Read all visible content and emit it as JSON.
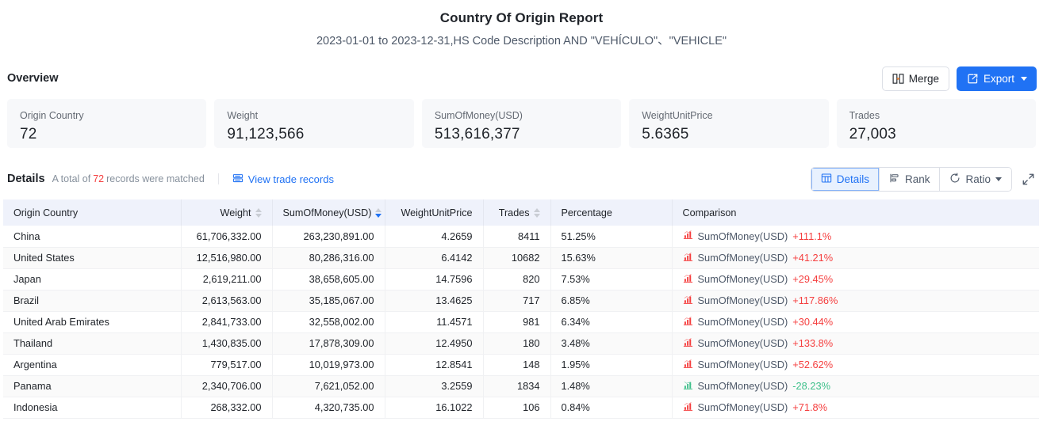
{
  "header": {
    "title": "Country Of Origin Report",
    "subtitle": "2023-01-01 to 2023-12-31,HS Code Description AND \"VEHÍCULO\"、\"VEHICLE\""
  },
  "overview": {
    "label": "Overview",
    "merge_label": "Merge",
    "export_label": "Export",
    "cards": [
      {
        "label": "Origin Country",
        "value": "72"
      },
      {
        "label": "Weight",
        "value": "91,123,566"
      },
      {
        "label": "SumOfMoney(USD)",
        "value": "513,616,377"
      },
      {
        "label": "WeightUnitPrice",
        "value": "5.6365"
      },
      {
        "label": "Trades",
        "value": "27,003"
      }
    ]
  },
  "details": {
    "title": "Details",
    "meta_prefix": "A total of",
    "record_count": "72",
    "meta_suffix": "records were matched",
    "view_trade_records": "View trade records",
    "view_modes": [
      {
        "label": "Details",
        "icon": "table-icon",
        "active": true
      },
      {
        "label": "Rank",
        "icon": "rank-icon",
        "active": false
      },
      {
        "label": "Ratio",
        "icon": "ratio-icon",
        "active": false,
        "caret": true
      }
    ],
    "fullscreen_label": "Fullscreen"
  },
  "table": {
    "columns": [
      {
        "key": "country",
        "label": "Origin Country",
        "align": "left",
        "sortable": false
      },
      {
        "key": "weight",
        "label": "Weight",
        "align": "right",
        "sortable": true,
        "sort": "none"
      },
      {
        "key": "money",
        "label": "SumOfMoney(USD)",
        "align": "right",
        "sortable": true,
        "sort": "desc"
      },
      {
        "key": "unitprice",
        "label": "WeightUnitPrice",
        "align": "right",
        "sortable": false
      },
      {
        "key": "trades",
        "label": "Trades",
        "align": "right",
        "sortable": true,
        "sort": "none"
      },
      {
        "key": "percentage",
        "label": "Percentage",
        "align": "left",
        "sortable": false
      },
      {
        "key": "comparison",
        "label": "Comparison",
        "align": "left",
        "sortable": false
      }
    ],
    "comparison_metric": "SumOfMoney(USD)",
    "rows": [
      {
        "country": "China",
        "weight": "61,706,332.00",
        "money": "263,230,891.00",
        "unitprice": "4.2659",
        "trades": "8411",
        "percentage": "51.25%",
        "delta": "+111.1%",
        "direction": "up"
      },
      {
        "country": "United States",
        "weight": "12,516,980.00",
        "money": "80,286,316.00",
        "unitprice": "6.4142",
        "trades": "10682",
        "percentage": "15.63%",
        "delta": "+41.21%",
        "direction": "up"
      },
      {
        "country": "Japan",
        "weight": "2,619,211.00",
        "money": "38,658,605.00",
        "unitprice": "14.7596",
        "trades": "820",
        "percentage": "7.53%",
        "delta": "+29.45%",
        "direction": "up"
      },
      {
        "country": "Brazil",
        "weight": "2,613,563.00",
        "money": "35,185,067.00",
        "unitprice": "13.4625",
        "trades": "717",
        "percentage": "6.85%",
        "delta": "+117.86%",
        "direction": "up"
      },
      {
        "country": "United Arab Emirates",
        "weight": "2,841,733.00",
        "money": "32,558,002.00",
        "unitprice": "11.4571",
        "trades": "981",
        "percentage": "6.34%",
        "delta": "+30.44%",
        "direction": "up"
      },
      {
        "country": "Thailand",
        "weight": "1,430,835.00",
        "money": "17,878,309.00",
        "unitprice": "12.4950",
        "trades": "180",
        "percentage": "3.48%",
        "delta": "+133.8%",
        "direction": "up"
      },
      {
        "country": "Argentina",
        "weight": "779,517.00",
        "money": "10,019,973.00",
        "unitprice": "12.8541",
        "trades": "148",
        "percentage": "1.95%",
        "delta": "+52.62%",
        "direction": "up"
      },
      {
        "country": "Panama",
        "weight": "2,340,706.00",
        "money": "7,621,052.00",
        "unitprice": "3.2559",
        "trades": "1834",
        "percentage": "1.48%",
        "delta": "-28.23%",
        "direction": "down"
      },
      {
        "country": "Indonesia",
        "weight": "268,332.00",
        "money": "4,320,735.00",
        "unitprice": "16.1022",
        "trades": "106",
        "percentage": "0.84%",
        "delta": "+71.8%",
        "direction": "up"
      }
    ]
  },
  "colors": {
    "accent": "#2072f4",
    "up": "#f53f3f",
    "down": "#3fc08b",
    "header_bg": "#eff2fb",
    "card_bg": "#f7f8fa"
  }
}
